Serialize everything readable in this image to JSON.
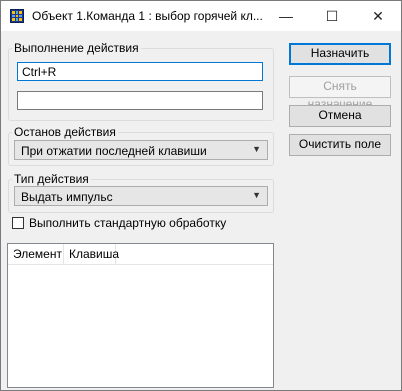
{
  "window": {
    "title": "Объект 1.Команда 1 : выбор горячей кл..."
  },
  "titlebar_controls": {
    "minimize": "—",
    "maximize": "☐",
    "close": "✕"
  },
  "action_group": {
    "label": "Выполнение действия",
    "hotkey_value": "Ctrl+R",
    "second_value": ""
  },
  "stop_group": {
    "label": "Останов действия",
    "selected": "При отжатии последней клавиши"
  },
  "type_group": {
    "label": "Тип действия",
    "selected": "Выдать импульс"
  },
  "checkbox": {
    "label": "Выполнить стандартную обработку",
    "checked": false
  },
  "buttons": {
    "assign": "Назначить",
    "unassign": "Снять назначение",
    "cancel": "Отмена",
    "clear": "Очистить поле"
  },
  "list": {
    "columns": [
      "Элемент",
      "Клавиша"
    ],
    "rows": []
  },
  "icons": {
    "combo_arrow": "chevron-down-icon"
  },
  "colors": {
    "accent": "#0078d7"
  }
}
